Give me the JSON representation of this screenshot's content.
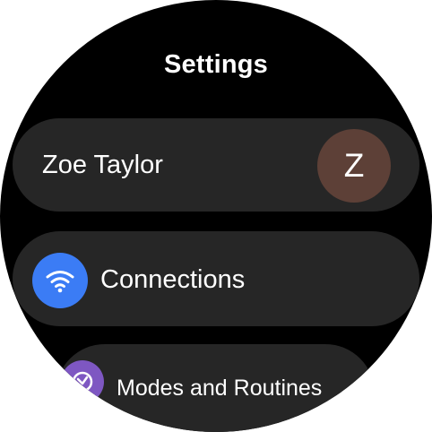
{
  "header": {
    "title": "Settings"
  },
  "profile": {
    "name": "Zoe Taylor",
    "avatar_initial": "Z",
    "avatar_color": "#5d4037"
  },
  "menu": {
    "items": [
      {
        "label": "Connections",
        "icon": "wifi-icon",
        "icon_color": "#3b7cf5"
      },
      {
        "label": "Modes and Routines",
        "icon": "modes-routines-icon",
        "icon_color": "#7e57c2"
      }
    ]
  }
}
